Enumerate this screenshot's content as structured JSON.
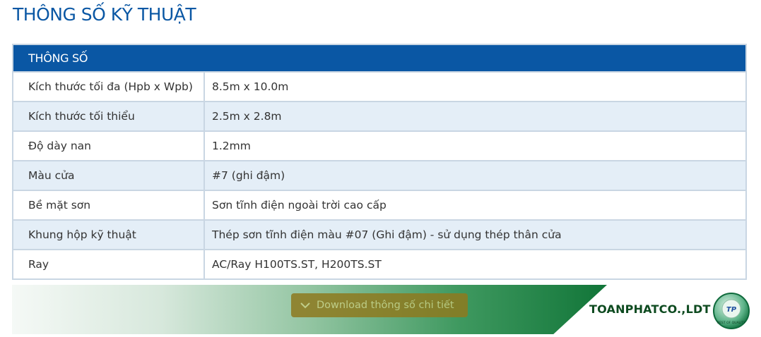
{
  "section_title": "THÔNG SỐ KỸ THUẬT",
  "table": {
    "header": "THÔNG SỐ",
    "rows": [
      {
        "label": "Kích thước tối đa (Hpb x Wpb)",
        "value": "8.5m x 10.0m"
      },
      {
        "label": "Kích thước tối thiểu",
        "value": "2.5m x 2.8m"
      },
      {
        "label": "Độ dày nan",
        "value": "1.2mm"
      },
      {
        "label": "Màu cửa",
        "value": "#7 (ghi đậm)"
      },
      {
        "label": "Bề mặt sơn",
        "value": "Sơn tĩnh điện ngoài trời cao cấp"
      },
      {
        "label": "Khung hộp kỹ thuật",
        "value": "Thép sơn tĩnh điện màu #07 (Ghi đậm) - sử dụng thép thân cửa"
      },
      {
        "label": "Ray",
        "value": "AC/Ray H100TS.ST, H200TS.ST"
      }
    ]
  },
  "banner": {
    "download_label": "Download thông số chi tiết",
    "download_icon": "chevron-down-icon",
    "brand_name": "TOANPHATCO.,LDT",
    "logo_text": "TP",
    "logo_caption": "BEST OF QUALITY"
  },
  "colors": {
    "accent": "#0a57a4",
    "row_alt": "#e4eef7",
    "banner_green": "#117538",
    "button_bg": "#8e7a1f"
  }
}
